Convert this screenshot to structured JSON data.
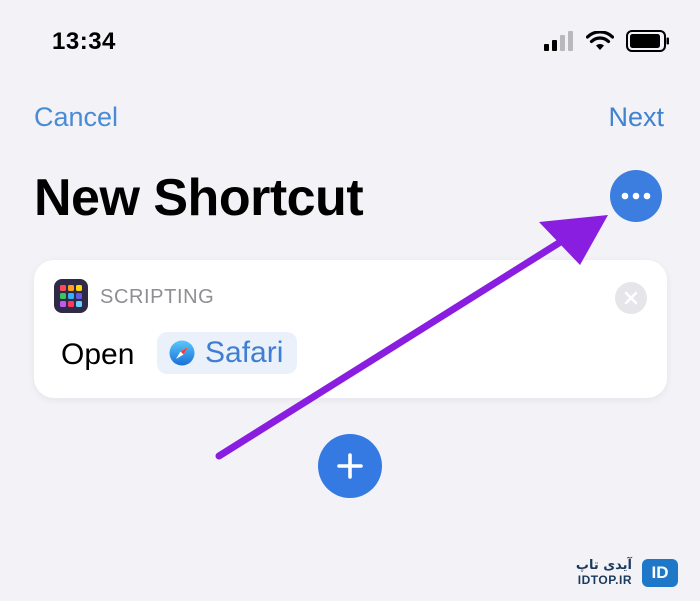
{
  "status_bar": {
    "time": "13:34",
    "icons": [
      "cellular-signal-icon",
      "wifi-icon",
      "battery-icon"
    ]
  },
  "nav": {
    "cancel_label": "Cancel",
    "next_label": "Next"
  },
  "page": {
    "title": "New Shortcut",
    "more_button_icon": "ellipsis-icon"
  },
  "action_card": {
    "category_icon": "scripting-grid-icon",
    "category_label": "SCRIPTING",
    "remove_icon": "close-circle-icon",
    "verb": "Open",
    "app_token": {
      "icon": "safari-compass-icon",
      "label": "Safari"
    }
  },
  "add_action": {
    "icon": "plus-icon"
  },
  "annotation": {
    "arrow_color": "#8a1ee0",
    "points_to": "more-button"
  },
  "watermark": {
    "persian_text": "آیدی تاپ",
    "site": "IDTOP.IR",
    "logo_text": "ID"
  },
  "colors": {
    "accent": "#3b7ee0",
    "background": "#f2f2f7",
    "card": "#ffffff"
  }
}
